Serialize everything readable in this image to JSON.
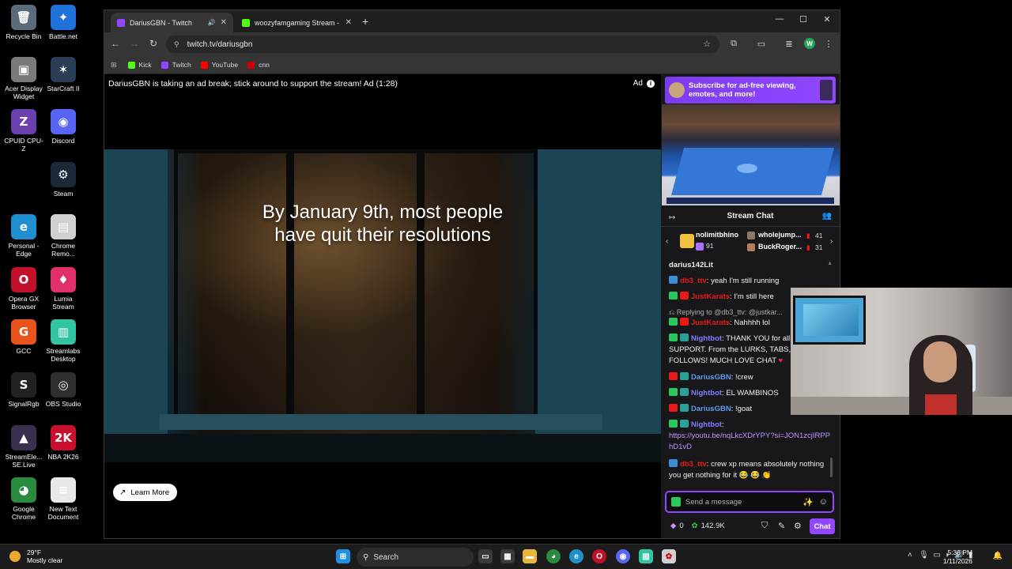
{
  "desktop": {
    "icons": [
      {
        "label": "Recycle Bin",
        "glyph": "🗑",
        "color": "#5a6b7b"
      },
      {
        "label": "Battle.net",
        "glyph": "✦",
        "color": "#1e72d9"
      },
      {
        "label": "Acer Display Widget",
        "glyph": "▣",
        "color": "#7a7a7a"
      },
      {
        "label": "StarCraft II",
        "glyph": "✶",
        "color": "#2b3d55"
      },
      {
        "label": "CPUID CPU-Z",
        "glyph": "Z",
        "color": "#6a3fb0"
      },
      {
        "label": "Discord",
        "glyph": "◉",
        "color": "#5865f2"
      },
      {
        "label": "Steam",
        "glyph": "⚙",
        "color": "#1b2838"
      },
      {
        "label": "Personal - Edge",
        "glyph": "e",
        "color": "#1f8fcf"
      },
      {
        "label": "Chrome Remo...",
        "glyph": "▤",
        "color": "#d0d0d0"
      },
      {
        "label": "Opera GX Browser",
        "glyph": "O",
        "color": "#c0102a"
      },
      {
        "label": "Lumia Stream",
        "glyph": "♦",
        "color": "#e0306a"
      },
      {
        "label": "GCC",
        "glyph": "G",
        "color": "#e8541c"
      },
      {
        "label": "Streamlabs Desktop",
        "glyph": "▥",
        "color": "#31c3a2"
      },
      {
        "label": "SignalRgb",
        "glyph": "S",
        "color": "#222"
      },
      {
        "label": "OBS Studio",
        "glyph": "◎",
        "color": "#302e31"
      },
      {
        "label": "StreamEle... SE.Live",
        "glyph": "▲",
        "color": "#3a2f4f"
      },
      {
        "label": "NBA 2K26",
        "glyph": "2K",
        "color": "#c8102e"
      },
      {
        "label": "Google Chrome",
        "glyph": "◕",
        "color": "#2a8a3e"
      },
      {
        "label": "New Text Document",
        "glyph": "≡",
        "color": "#e8e8e8"
      }
    ]
  },
  "browser": {
    "tabs": [
      {
        "title": "DariusGBN - Twitch",
        "favicon_color": "#9147ff"
      },
      {
        "title": "woozyfamgaming Stream - Wa...",
        "favicon_color": "#53fc18"
      }
    ],
    "url": "twitch.tv/dariusgbn",
    "bookmarks": [
      {
        "label": "Kick",
        "color": "#53fc18"
      },
      {
        "label": "Twitch",
        "color": "#9147ff"
      },
      {
        "label": "YouTube",
        "color": "#ff0000"
      },
      {
        "label": "cnn",
        "color": "#cc0000"
      }
    ],
    "profile_initial": "W"
  },
  "player": {
    "ad_banner": "DariusGBN is taking an ad break; stick around to support the stream! Ad (1:28)",
    "ad_label": "Ad",
    "ad_info": "i",
    "ad_headline_1": "By January 9th, most people",
    "ad_headline_2": "have quit their resolutions",
    "learn_more": "Learn More"
  },
  "sidebar": {
    "sub_banner_line1": "Subscribe for ad-free viewing,",
    "sub_banner_line2": "emotes, and more!",
    "chat_title": "Stream Chat",
    "leaderboard": {
      "first_name": "nolimitbhino",
      "first_value": "91",
      "second_name": "wholejump...",
      "second_value": "41",
      "third_name": "BuckRoger...",
      "third_value": "31"
    },
    "messages": [
      {
        "user": "darius142Lit",
        "color": "#efeff1",
        "text": "",
        "badges": []
      },
      {
        "user": "db3_ttv",
        "color": "#e91916",
        "text": ": yeah I'm still running",
        "badges": [
          "b-blue"
        ]
      },
      {
        "user": "JustKarats",
        "color": "#e91916",
        "text": ": I'm still here",
        "badges": [
          "b-green",
          "b-red"
        ]
      },
      {
        "user": "",
        "color": "#adadb8",
        "text": "Replying to @db3_ttv: @justkar...",
        "badges": []
      },
      {
        "user": "JustKarats",
        "color": "#e91916",
        "text": ": Nahhhh lol",
        "badges": [
          "b-green",
          "b-red"
        ]
      },
      {
        "user": "Nightbot",
        "color": "#7e7eff",
        "text": ": THANK YOU for all the SUPPORT. From the LURKS, TABS, FOLLOWS! MUCH LOVE CHAT",
        "badges": [
          "b-green",
          "b-teal"
        ]
      },
      {
        "user": "DariusGBN",
        "color": "#5b9cf0",
        "text": ": !crew",
        "badges": [
          "b-red",
          "b-teal"
        ]
      },
      {
        "user": "Nightbot",
        "color": "#7e7eff",
        "text": ": EL WAMBINOS",
        "badges": [
          "b-green",
          "b-teal"
        ]
      },
      {
        "user": "DariusGBN",
        "color": "#5b9cf0",
        "text": ": !goat",
        "badges": [
          "b-red",
          "b-teal"
        ]
      },
      {
        "user": "Nightbot",
        "color": "#7e7eff",
        "text": ":",
        "badges": [
          "b-green",
          "b-teal"
        ]
      },
      {
        "user": "",
        "color": "#bf94ff",
        "text": "https://youtu.be/nqLkcXDrYPY?si=JON1zcjIRPPhD1vD",
        "badges": []
      },
      {
        "user": "db3_ttv",
        "color": "#e91916",
        "text": ": crew xp means absolutely nothing you get nothing for it 😂 😂 👏",
        "badges": [
          "b-blue"
        ]
      }
    ],
    "input_placeholder": "Send a message",
    "points": "0",
    "channel_points": "142.9K",
    "chat_button": "Chat"
  },
  "taskbar": {
    "temp": "29°F",
    "weather": "Mostly clear",
    "search": "Search",
    "time": "5:36 PM",
    "date": "1/11/2026"
  }
}
